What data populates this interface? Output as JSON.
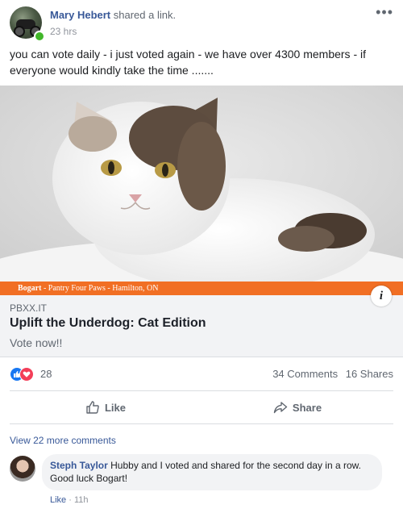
{
  "post": {
    "author": "Mary Hebert",
    "action": "shared a link.",
    "time": "23 hrs",
    "more": "•••",
    "message": "you can vote daily - i just voted again - we have over 4300 members - if everyone would kindly take the time .......",
    "image_caption_name": "Bogart",
    "image_caption_rest": " - Pantry Four Paws - Hamilton, ON"
  },
  "link": {
    "domain": "PBXX.IT",
    "title": "Uplift the Underdog: Cat Edition",
    "description": "Vote now!!",
    "info_glyph": "i"
  },
  "stats": {
    "reactions_count": "28",
    "comments": "34 Comments",
    "shares": "16 Shares"
  },
  "actions": {
    "like": "Like",
    "share": "Share"
  },
  "comments": {
    "view_more": "View 22 more comments",
    "items": [
      {
        "author": "Steph Taylor",
        "text": " Hubby and I voted and shared for the second day in a row. Good luck Bogart!",
        "like_label": "Like",
        "separator": " · ",
        "time": "11h"
      }
    ]
  },
  "colors": {
    "link_blue": "#385898",
    "banner_orange": "#f16f24",
    "like_blue": "#1877f2",
    "love_red": "#f33e58",
    "online_green": "#42b72a"
  }
}
